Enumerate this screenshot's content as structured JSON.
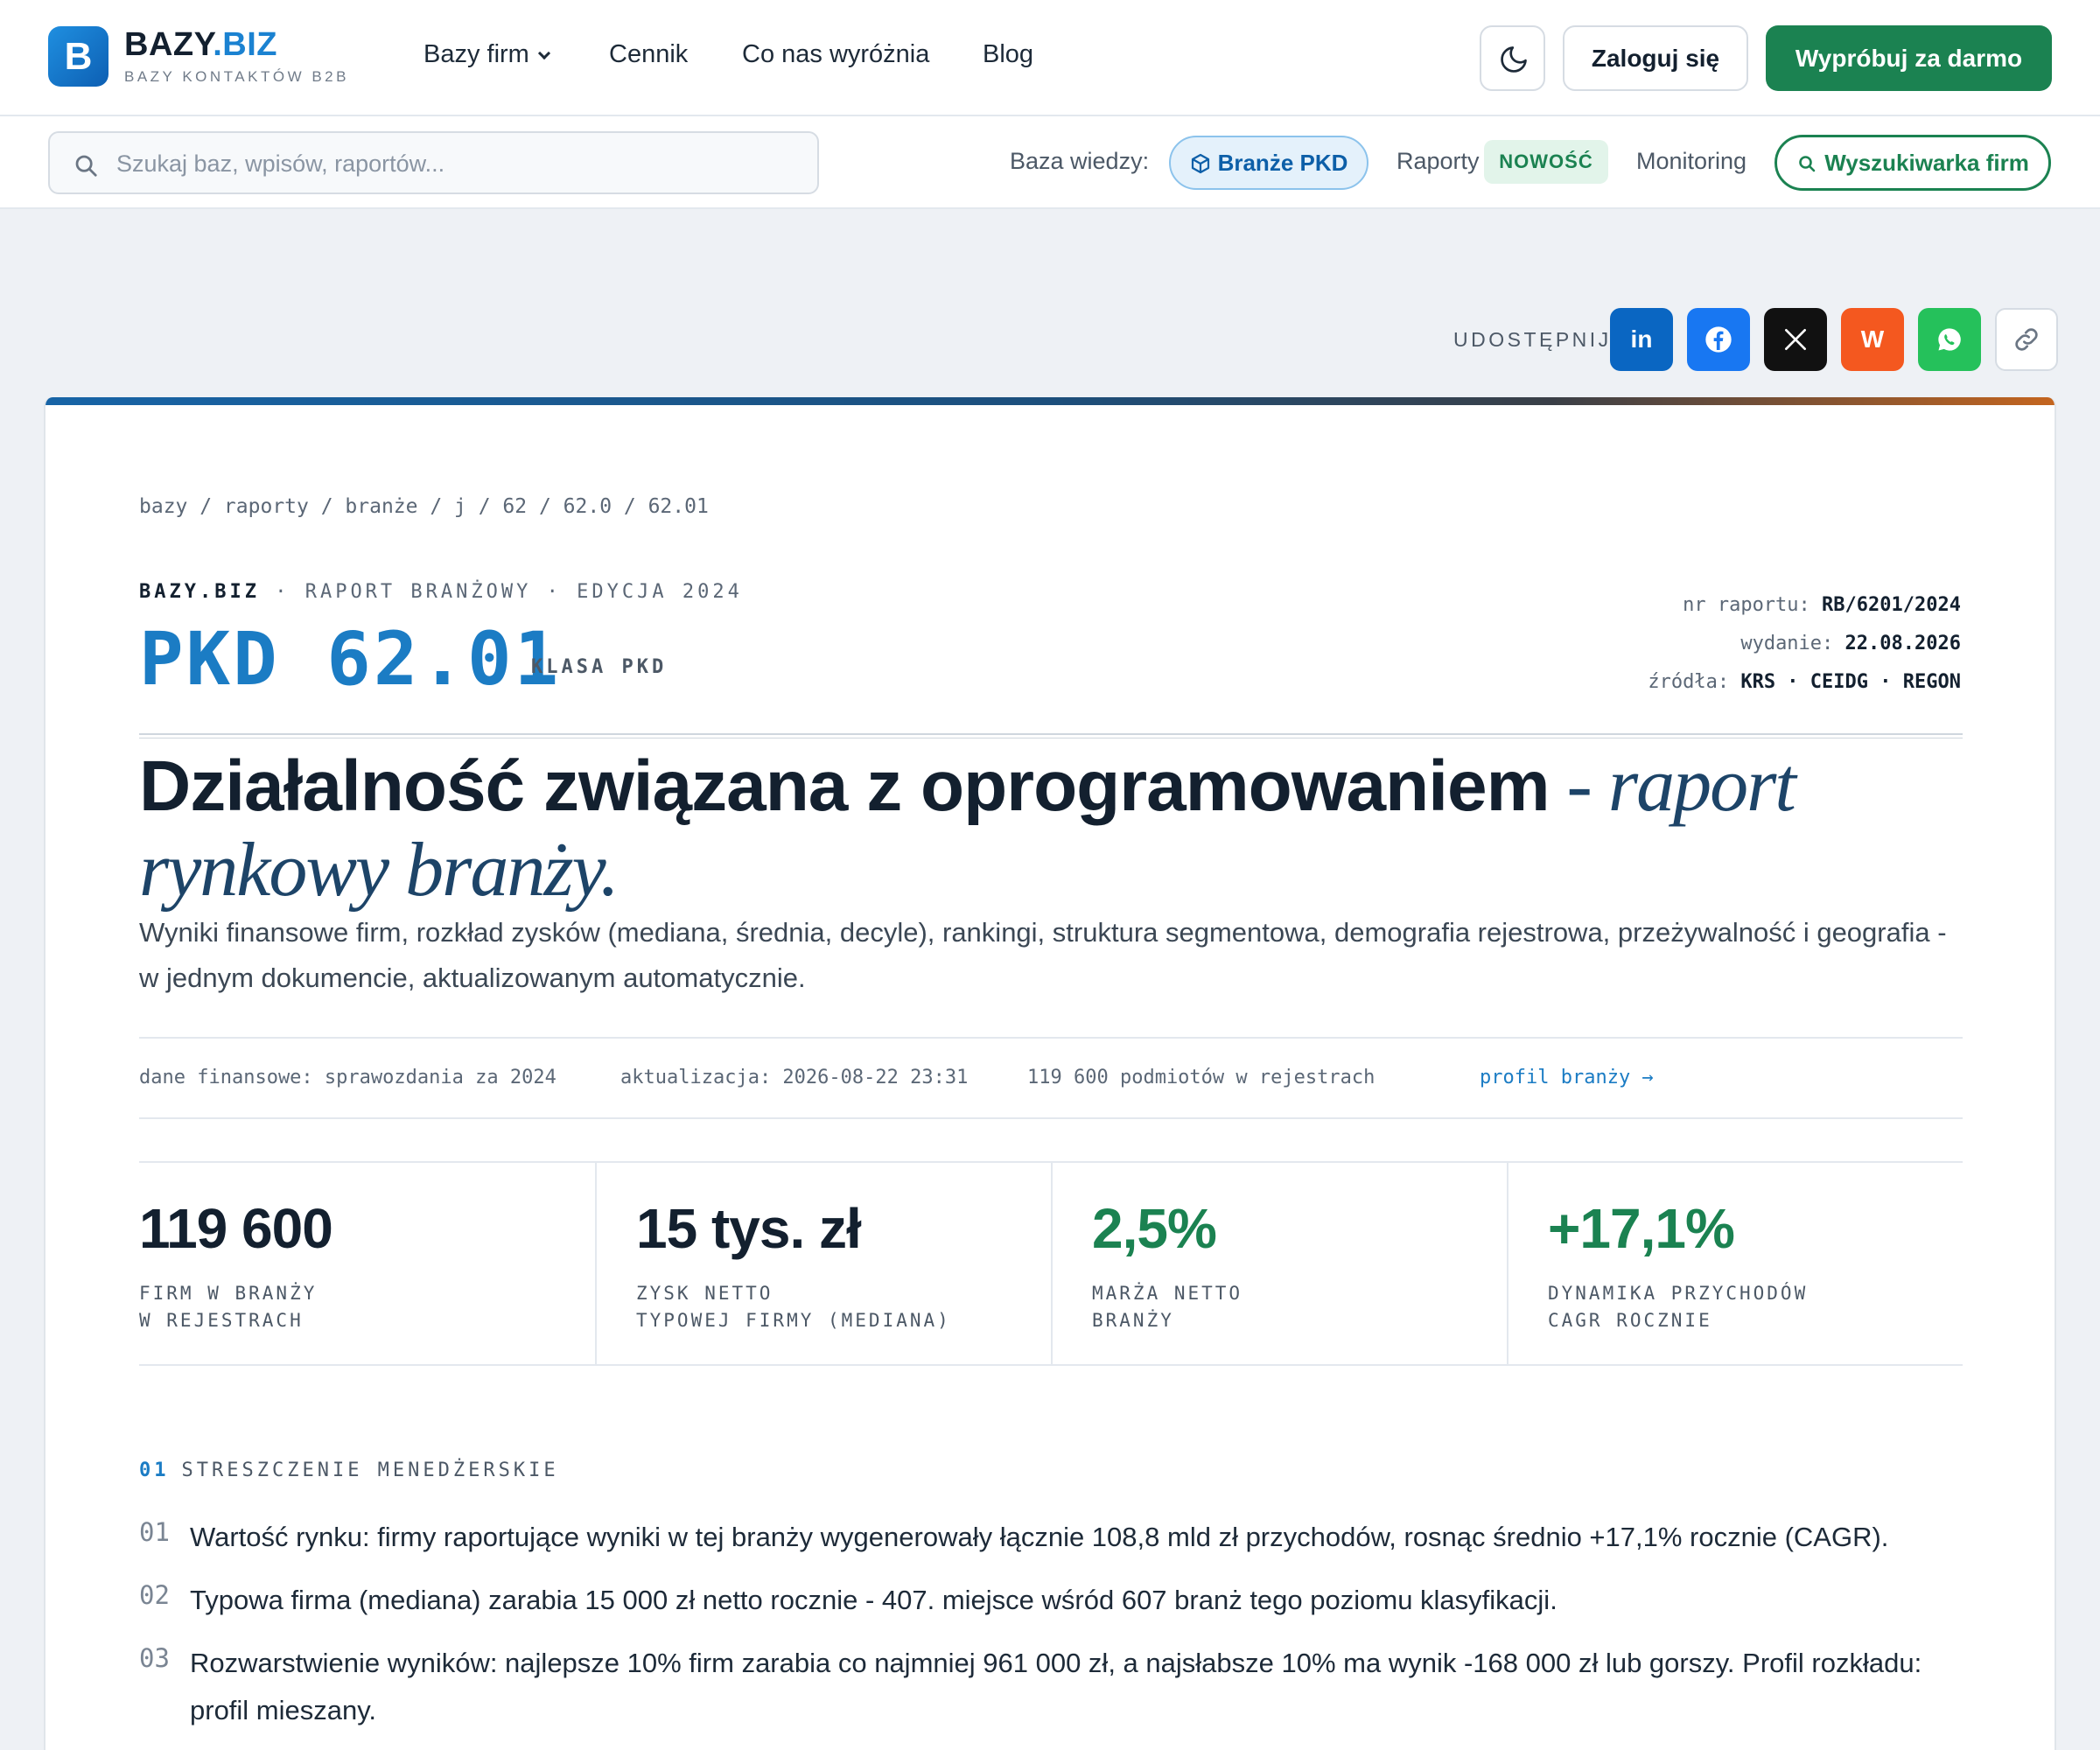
{
  "brand": {
    "logo_letter": "B",
    "name_main": "BAZY",
    "name_accent": ".BIZ",
    "tagline": "BAZY KONTAKTÓW B2B"
  },
  "nav": {
    "items": [
      "Bazy firm",
      "Cennik",
      "Co nas wyróżnia",
      "Blog"
    ],
    "login": "Zaloguj się",
    "try_free": "Wypróbuj za darmo"
  },
  "subbar": {
    "search_placeholder": "Szukaj baz, wpisów, raportów...",
    "kb_label": "Baza wiedzy:",
    "pkd_pill": "Branże PKD",
    "raporty": "Raporty",
    "new_badge": "NOWOŚĆ",
    "monitoring": "Monitoring",
    "finder": "Wyszukiwarka firm"
  },
  "share": {
    "label": "UDOSTĘPNIJ",
    "buttons": [
      {
        "name": "linkedin",
        "glyph": "in",
        "color": "#0a66c2"
      },
      {
        "name": "facebook",
        "glyph": "f",
        "color": "#1877f2"
      },
      {
        "name": "x",
        "glyph": "X",
        "color": "#111111"
      },
      {
        "name": "wykop",
        "glyph": "W",
        "color": "#f4581f"
      },
      {
        "name": "whatsapp",
        "glyph": "wa",
        "color": "#25c15b"
      },
      {
        "name": "copy-link",
        "glyph": "link",
        "color": "#ffffff"
      }
    ]
  },
  "report": {
    "breadcrumb": "bazy / raporty / branże / j / 62 / 62.0 / 62.01",
    "brand_line_bold": "BAZY.BIZ",
    "brand_line_rest": " · RAPORT BRANŻOWY · EDYCJA 2024",
    "pkd_code": "PKD 62.01",
    "klasa": "KLASA PKD",
    "meta": {
      "nr_label": "nr raportu:",
      "nr_value": "RB/6201/2024",
      "wydanie_label": "wydanie:",
      "wydanie_value": "22.08.2026",
      "zrodla_label": "źródła:",
      "zrodla_value": "KRS · CEIDG · REGON"
    },
    "title_main": "Działalność związana z oprogramowaniem",
    "title_italic": " - raport rynkowy branży.",
    "lead": "Wyniki finansowe firm, rozkład zysków (mediana, średnia, decyle), rankingi, struktura segmentowa, demografia rejestrowa, przeżywalność i geografia - w jednym dokumencie, aktualizowanym automatycznie.",
    "meta_row": {
      "finance": "dane finansowe: sprawozdania za 2024",
      "update": "aktualizacja: 2026-08-22 23:31",
      "entities": "119 600 podmiotów w rejestrach",
      "profile_link": "profil branży →"
    },
    "kpis": [
      {
        "value": "119 600",
        "label1": "FIRM W BRANŻY",
        "label2": "W REJESTRACH",
        "accent": false
      },
      {
        "value": "15 tys. zł",
        "label1": "ZYSK NETTO",
        "label2": "TYPOWEJ FIRMY (MEDIANA)",
        "accent": false
      },
      {
        "value": "2,5%",
        "label1": "MARŻA NETTO",
        "label2": "BRANŻY",
        "accent": true
      },
      {
        "value": "+17,1%",
        "label1": "DYNAMIKA PRZYCHODÓW",
        "label2": "CAGR ROCZNIE",
        "accent": true
      }
    ],
    "section": {
      "num": "01",
      "title": "STRESZCZENIE MENEDŻERSKIE"
    },
    "points": [
      {
        "num": "01",
        "text": "Wartość rynku: firmy raportujące wyniki w tej branży wygenerowały łącznie 108,8 mld zł przychodów, rosnąc średnio +17,1% rocznie (CAGR)."
      },
      {
        "num": "02",
        "text": "Typowa firma (mediana) zarabia 15 000 zł netto rocznie - 407. miejsce wśród 607 branż tego poziomu klasyfikacji."
      },
      {
        "num": "03",
        "text": "Rozwarstwienie wyników: najlepsze 10% firm zarabia co najmniej 961 000 zł, a najsłabsze 10% ma wynik -168 000 zł lub gorszy. Profil rozkładu: profil mieszany."
      }
    ]
  }
}
